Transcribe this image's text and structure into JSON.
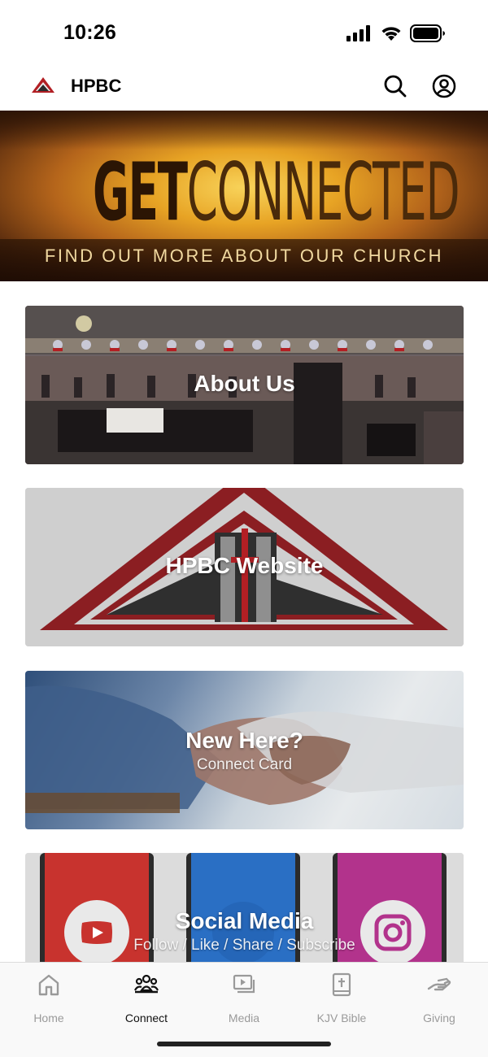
{
  "status_bar": {
    "time": "10:26",
    "icons": [
      "cellular-signal-icon",
      "wifi-icon",
      "battery-icon"
    ]
  },
  "header": {
    "title": "HPBC",
    "logo_icon": "church-logo-icon",
    "actions": [
      "search-icon",
      "profile-icon"
    ]
  },
  "hero": {
    "title_bold": "GET",
    "title_light": "CONNECTED",
    "subtitle": "FIND OUT MORE ABOUT OUR CHURCH"
  },
  "cards": [
    {
      "label": "About Us"
    },
    {
      "label": "HPBC Website"
    },
    {
      "label": "New Here?",
      "sublabel": "Connect Card"
    },
    {
      "label": "Social Media",
      "sublabel": "Follow / Like / Share / Subscribe"
    }
  ],
  "tab_bar": {
    "tabs": [
      {
        "label": "Home",
        "icon": "home-icon",
        "active": false
      },
      {
        "label": "Connect",
        "icon": "people-group-icon",
        "active": true
      },
      {
        "label": "Media",
        "icon": "media-play-icon",
        "active": false
      },
      {
        "label": "KJV Bible",
        "icon": "bible-icon",
        "active": false
      },
      {
        "label": "Giving",
        "icon": "giving-hand-icon",
        "active": false
      }
    ]
  },
  "colors": {
    "brand_red": "#b21f24",
    "active_tab": "#111111",
    "inactive_tab": "#9a9a9a"
  }
}
